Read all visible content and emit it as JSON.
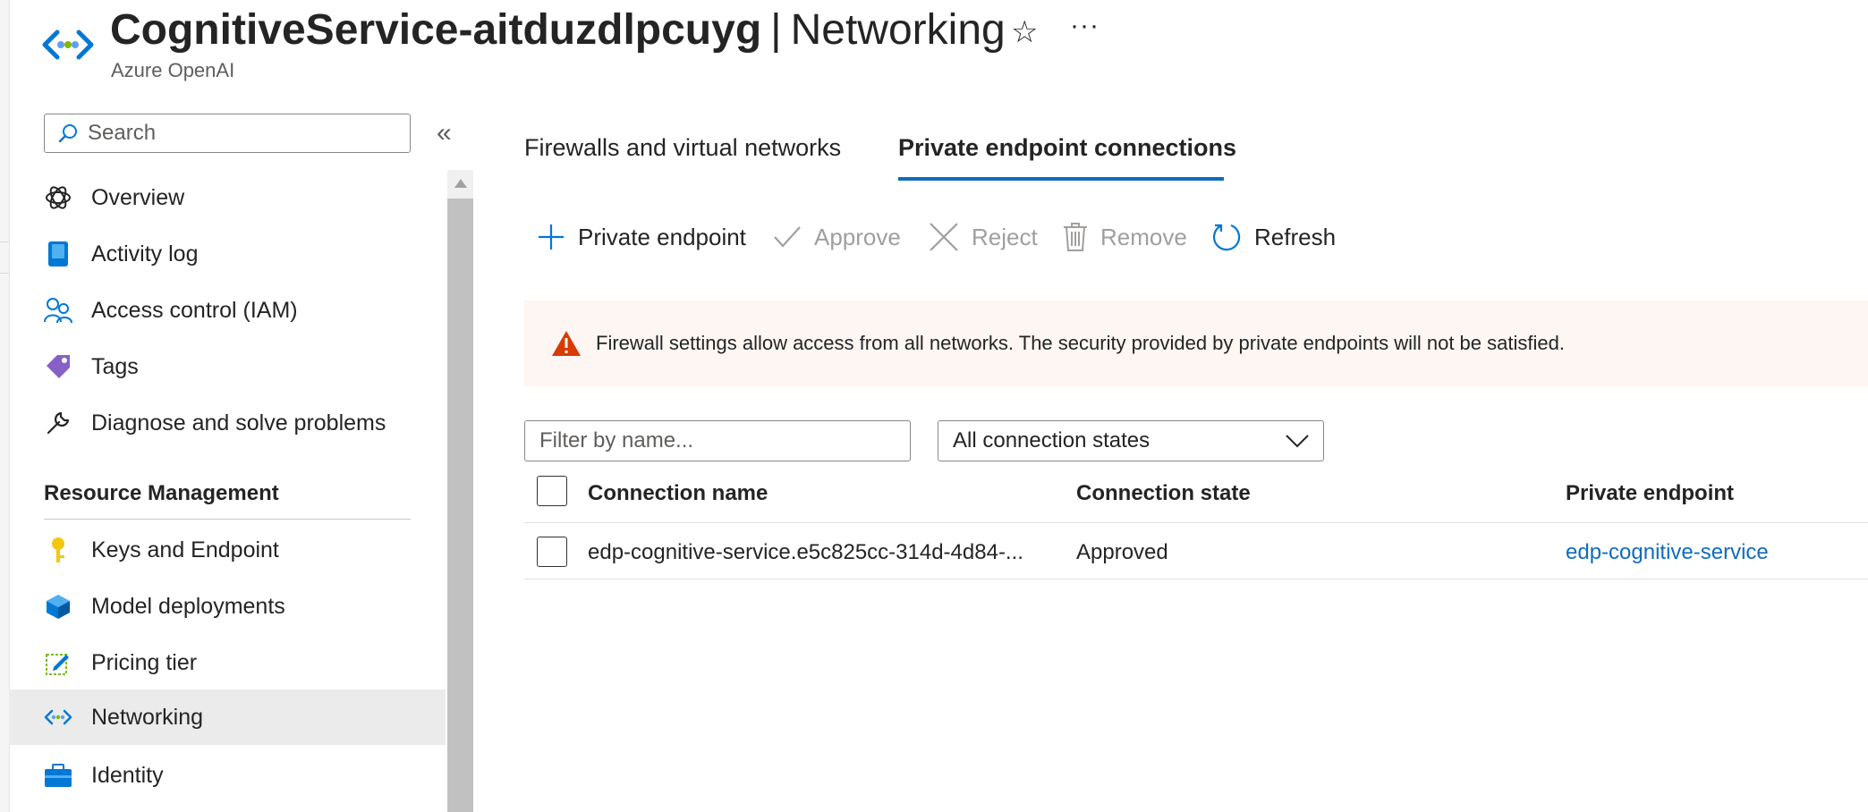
{
  "header": {
    "title_resource": "CognitiveService-aitduzdlpcuyg",
    "title_separator": "|",
    "title_page": "Networking",
    "subtitle": "Azure OpenAI",
    "favorite_icon": "star-icon",
    "more_icon": "ellipsis-icon",
    "more_glyph": "···",
    "favorite_glyph": "☆"
  },
  "sidebar": {
    "search_placeholder": "Search",
    "collapse_glyph": "«",
    "items": [
      {
        "label": "Overview",
        "icon": "openai-icon"
      },
      {
        "label": "Activity log",
        "icon": "activity-log-icon"
      },
      {
        "label": "Access control (IAM)",
        "icon": "people-icon"
      },
      {
        "label": "Tags",
        "icon": "tag-icon"
      },
      {
        "label": "Diagnose and solve problems",
        "icon": "wrench-icon"
      }
    ],
    "section_title": "Resource Management",
    "section_items": [
      {
        "label": "Keys and Endpoint",
        "icon": "key-icon"
      },
      {
        "label": "Model deployments",
        "icon": "cube-icon"
      },
      {
        "label": "Pricing tier",
        "icon": "pricing-edit-icon"
      },
      {
        "label": "Networking",
        "icon": "networking-icon",
        "active": true
      },
      {
        "label": "Identity",
        "icon": "identity-briefcase-icon"
      }
    ]
  },
  "tabs": [
    {
      "label": "Firewalls and virtual networks",
      "selected": false
    },
    {
      "label": "Private endpoint connections",
      "selected": true
    }
  ],
  "commands": [
    {
      "label": "Private endpoint",
      "icon": "plus-icon",
      "enabled": true
    },
    {
      "label": "Approve",
      "icon": "checkmark-icon",
      "enabled": false
    },
    {
      "label": "Reject",
      "icon": "close-icon",
      "enabled": false
    },
    {
      "label": "Remove",
      "icon": "trash-icon",
      "enabled": false
    },
    {
      "label": "Refresh",
      "icon": "refresh-icon",
      "enabled": true
    }
  ],
  "warning": {
    "icon": "warning-icon",
    "message": "Firewall settings allow access from all networks. The security provided by private endpoints will not be satisfied."
  },
  "filters": {
    "name_placeholder": "Filter by name...",
    "state_selected": "All connection states"
  },
  "table": {
    "columns": [
      "Connection name",
      "Connection state",
      "Private endpoint"
    ],
    "rows": [
      {
        "connection_name": "edp-cognitive-service.e5c825cc-314d-4d84-...",
        "connection_state": "Approved",
        "private_endpoint": "edp-cognitive-service"
      }
    ]
  },
  "colors": {
    "accent": "#0f6cbd",
    "warning": "#d83b01",
    "banner_bg": "#fdf6f3",
    "active_nav_bg": "#ebebeb"
  }
}
